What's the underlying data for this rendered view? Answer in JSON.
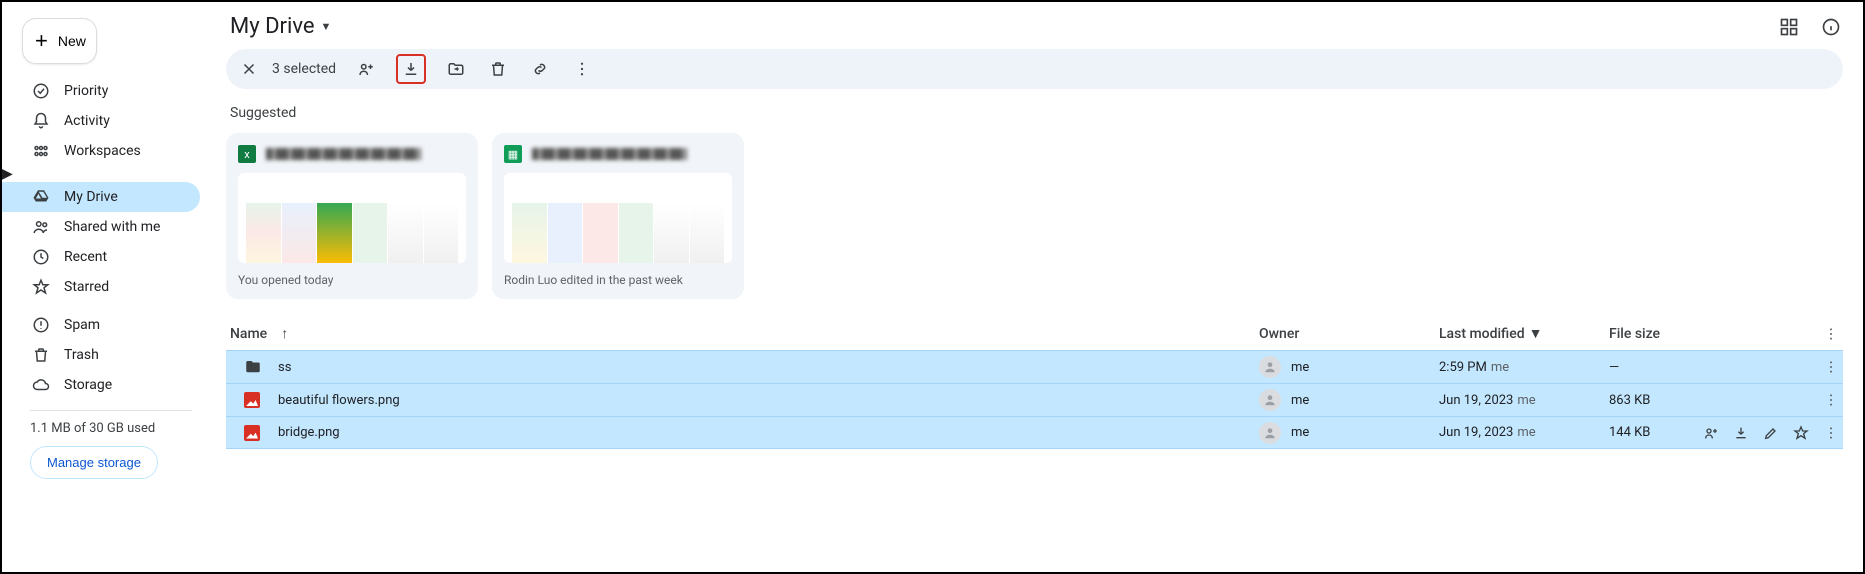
{
  "new_button": "New",
  "nav": {
    "priority": "Priority",
    "activity": "Activity",
    "workspaces": "Workspaces",
    "my_drive": "My Drive",
    "shared": "Shared with me",
    "recent": "Recent",
    "starred": "Starred",
    "spam": "Spam",
    "trash": "Trash",
    "storage": "Storage"
  },
  "storage_used": "1.1 MB of 30 GB used",
  "manage_storage": "Manage storage",
  "page_title": "My Drive",
  "selection": {
    "count_label": "3 selected"
  },
  "suggested_label": "Suggested",
  "cards": [
    {
      "caption": "You opened today"
    },
    {
      "caption": "Rodin Luo edited in the past week"
    }
  ],
  "columns": {
    "name": "Name",
    "owner": "Owner",
    "modified": "Last modified",
    "size": "File size"
  },
  "rows": [
    {
      "name": "ss",
      "owner": "me",
      "modified": "2:59 PM",
      "modified_by": "me",
      "size": "—",
      "type": "folder"
    },
    {
      "name": "beautiful flowers.png",
      "owner": "me",
      "modified": "Jun 19, 2023",
      "modified_by": "me",
      "size": "863 KB",
      "type": "image"
    },
    {
      "name": "bridge.png",
      "owner": "me",
      "modified": "Jun 19, 2023",
      "modified_by": "me",
      "size": "144 KB",
      "type": "image"
    }
  ]
}
